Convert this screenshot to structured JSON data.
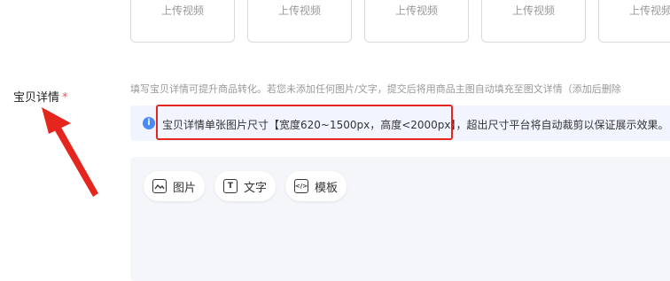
{
  "upload_slots": [
    "上传视频",
    "上传视频",
    "上传视频",
    "上传视频",
    "上传视频"
  ],
  "field": {
    "label": "宝贝详情",
    "required_mark": "*"
  },
  "hint": "填写宝贝详情可提升商品转化。若您未添加任何图片/文字，提交后将用商品主图自动填充至图文详情（添加后删除",
  "info": {
    "icon": "i",
    "text": "宝贝详情单张图片尺寸【宽度620~1500px，高度<2000px】，超出尺寸平台将自动裁剪以保证展示效果。"
  },
  "toolbar": {
    "image_label": "图片",
    "text_label": "文字",
    "template_label": "模板",
    "text_icon_glyph": "T",
    "template_icon_glyph": "</>"
  },
  "colors": {
    "annotation_red": "#e5261f",
    "info_blue": "#4a8af4",
    "info_bg": "#f0f5ff",
    "editor_bg": "#f5f6fa"
  }
}
